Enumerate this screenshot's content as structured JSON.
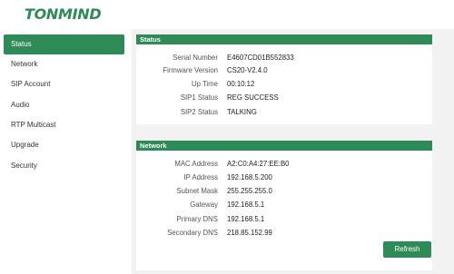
{
  "brand": {
    "logo_text": "TONMIND",
    "accent_color": "#2e8b57"
  },
  "sidebar": {
    "items": [
      {
        "label": "Status",
        "active": true
      },
      {
        "label": "Network",
        "active": false
      },
      {
        "label": "SIP Account",
        "active": false
      },
      {
        "label": "Audio",
        "active": false
      },
      {
        "label": "RTP Multicast",
        "active": false
      },
      {
        "label": "Upgrade",
        "active": false
      },
      {
        "label": "Security",
        "active": false
      }
    ]
  },
  "status_panel": {
    "title": "Status",
    "rows": [
      {
        "label": "Serial Number",
        "value": "E4607CD01B552833"
      },
      {
        "label": "Firmware Version",
        "value": "CS20-V2.4.0"
      },
      {
        "label": "Up Time",
        "value": "00:10:12"
      },
      {
        "label": "SIP1 Status",
        "value": "REG SUCCESS"
      },
      {
        "label": "SIP2 Status",
        "value": "TALKING"
      }
    ]
  },
  "network_panel": {
    "title": "Network",
    "rows": [
      {
        "label": "MAC Address",
        "value": "A2:C0:A4:27:EE:B0"
      },
      {
        "label": "IP Address",
        "value": "192.168.5.200"
      },
      {
        "label": "Subnet Mask",
        "value": "255.255.255.0"
      },
      {
        "label": "Gateway",
        "value": "192.168.5.1"
      },
      {
        "label": "Primary DNS",
        "value": "192.168.5.1"
      },
      {
        "label": "Secondary DNS",
        "value": "218.85.152.99"
      }
    ],
    "refresh_label": "Refresh"
  }
}
